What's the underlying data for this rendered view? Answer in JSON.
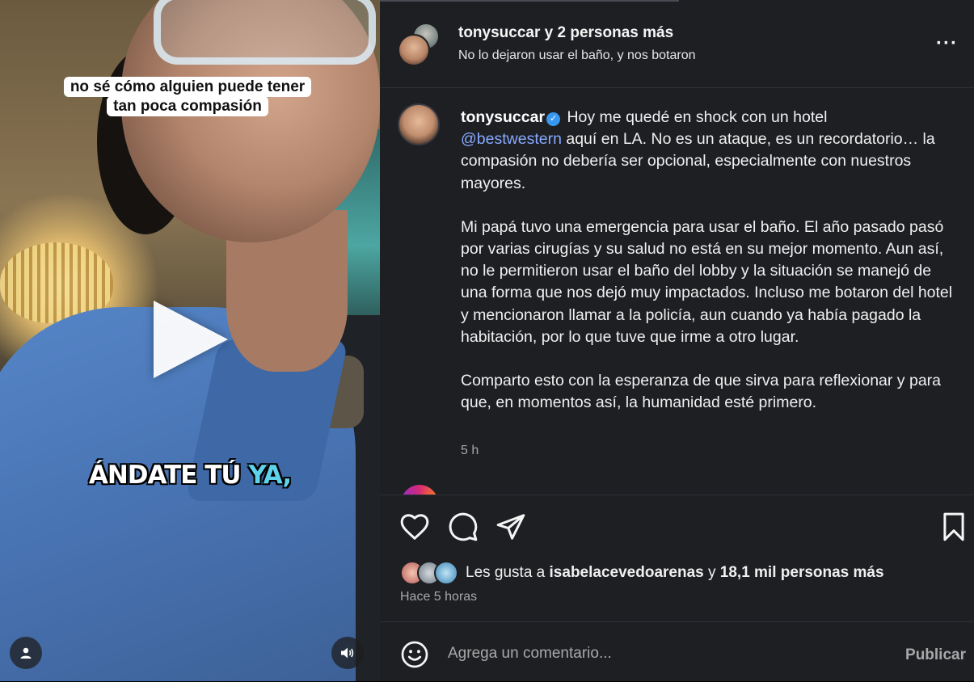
{
  "video": {
    "caption_line1": "no sé cómo alguien puede tener",
    "caption_line2": "tan poca compasión",
    "subtitle_main": "ÁNDATE TÚ ",
    "subtitle_highlight": "YA,",
    "play_icon": "play-icon",
    "profile_icon": "user-icon",
    "audio_icon": "speaker-icon"
  },
  "header": {
    "username": "tonysuccar",
    "collaborators": " y 2 personas más",
    "audio_label": "No lo dejaron usar el baño, y nos botaron",
    "more_icon": "more-options-icon",
    "more_glyph": "···"
  },
  "post": {
    "username": "tonysuccar",
    "verified_glyph": "✓",
    "line1": " Hoy me quedé en shock con un hotel",
    "mention": "@bestwestern",
    "line2": " aquí en LA. No es un ataque, es un recordatorio… la compasión no debería ser opcional, especialmente con nuestros mayores.",
    "paragraph2": "Mi papá tuvo una emergencia para usar el baño. El año pasado pasó por varias cirugías y su salud no está en su mejor momento. Aun así, no le permitieron usar el baño del lobby y la situación se manejó de una forma que nos dejó muy impactados. Incluso me botaron del hotel y mencionaron llamar a la policía, aun cuando ya había pagado la habitación, por lo que tuve que irme a otro lugar.",
    "paragraph3": "Comparto esto con la esperanza de que sirva para reflexionar y para que, en momentos así, la humanidad esté primero.",
    "time": "5 h"
  },
  "actions": {
    "like_icon": "heart-icon",
    "comment_icon": "comment-icon",
    "share_icon": "send-icon",
    "save_icon": "bookmark-icon"
  },
  "likes": {
    "prefix": "Les gusta a ",
    "user": "isabelacevedoarenas",
    "suffix": " y ",
    "count": "18,1 mil personas más",
    "time_ago": "Hace 5 horas"
  },
  "comment": {
    "placeholder": "Agrega un comentario...",
    "emoji_icon": "emoji-icon",
    "publish_label": "Publicar"
  },
  "colors": {
    "panel_bg": "#1e1f23",
    "mention": "#86a8ff",
    "verified": "#3897f0",
    "muted": "#a8a8a8",
    "subtitle_highlight": "#5fd3ec"
  }
}
